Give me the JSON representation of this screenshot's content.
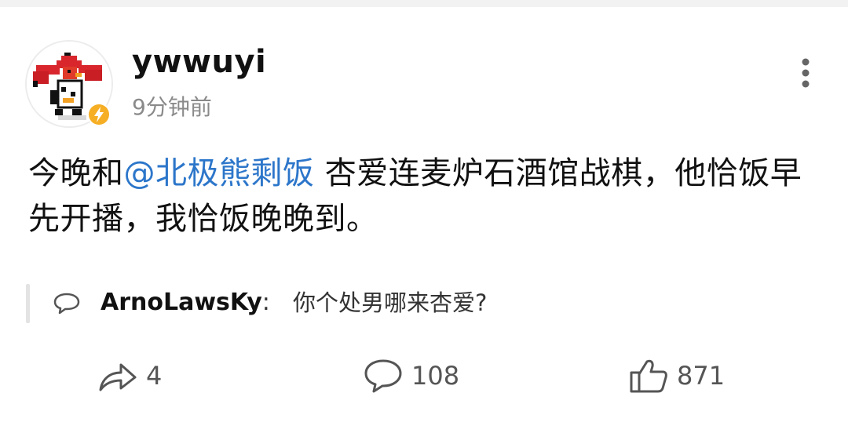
{
  "post": {
    "author": {
      "username": "ywwuyi",
      "avatar_icon": "pixel-chicken-avatar-icon",
      "verified_badge_icon": "lightning-badge-icon",
      "verified_badge_color": "#f6ae24"
    },
    "timestamp": "9分钟前",
    "more_menu_icon": "three-dots-vertical-icon",
    "content": {
      "text_before": "今晚和",
      "mention": "@北极熊剩饭",
      "text_after": " 杏爱连麦炉石酒馆战棋，他恰饭早先开播，我恰饭晚晚到。",
      "mention_color": "#2c76ca"
    },
    "top_comment": {
      "icon": "comment-bubble-icon",
      "username": "ArnoLawsKy",
      "separator": ":",
      "text": " 你个处男哪来杏爱?"
    },
    "actions": {
      "share": {
        "icon": "share-arrow-icon",
        "count": "4"
      },
      "comments": {
        "icon": "comment-bubble-icon",
        "count": "108"
      },
      "likes": {
        "icon": "thumbs-up-icon",
        "count": "871"
      }
    }
  }
}
